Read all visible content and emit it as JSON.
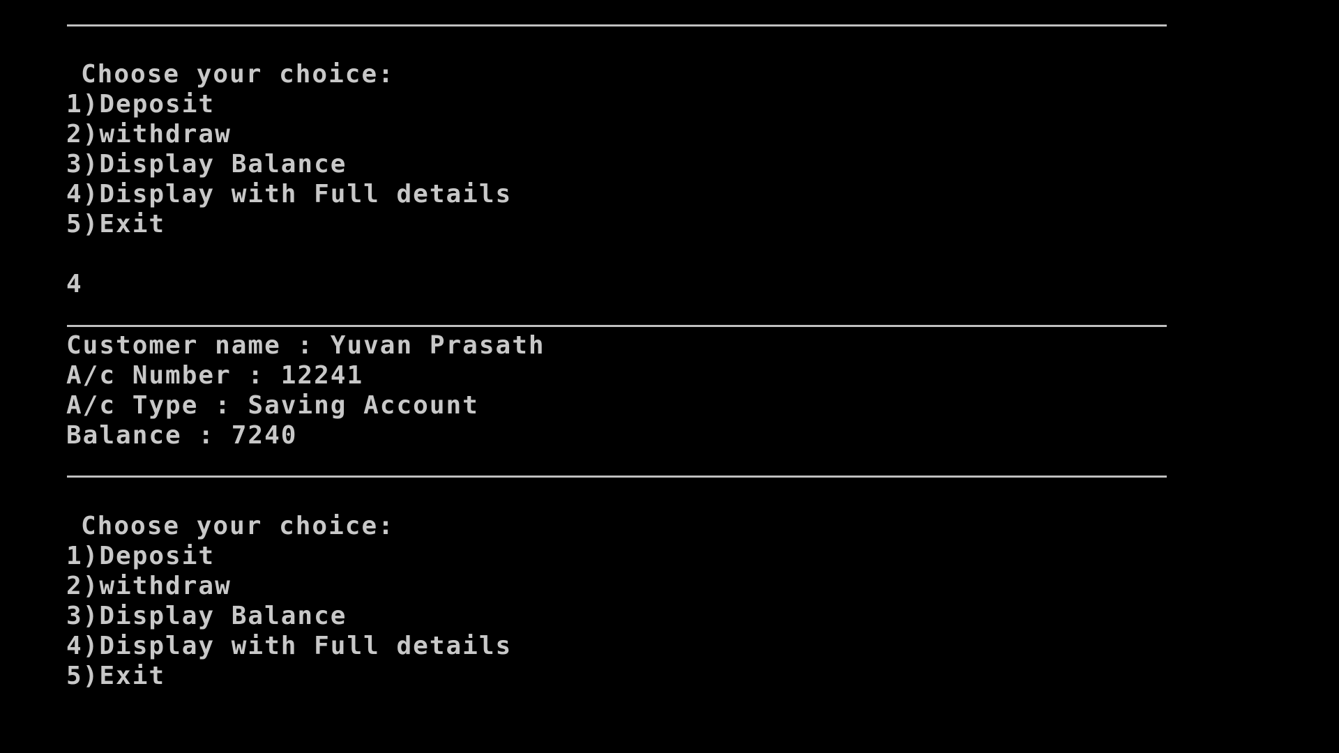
{
  "terminal": {
    "colors": {
      "background": "#000000",
      "text": "#c8c8c8",
      "rule": "#c0c0c0"
    },
    "menu_1": {
      "prompt": "Choose your choice:",
      "options": [
        "1)Deposit",
        "2)withdraw",
        "3)Display Balance",
        "4)Display with Full details",
        "5)Exit"
      ]
    },
    "user_input": "4",
    "details": {
      "customer_name": "Customer name : Yuvan Prasath",
      "account_number": "A/c Number : 12241",
      "account_type": "A/c Type : Saving Account",
      "balance": "Balance : 7240"
    },
    "menu_2": {
      "prompt": "Choose your choice:",
      "options": [
        "1)Deposit",
        "2)withdraw",
        "3)Display Balance",
        "4)Display with Full details",
        "5)Exit"
      ]
    }
  }
}
